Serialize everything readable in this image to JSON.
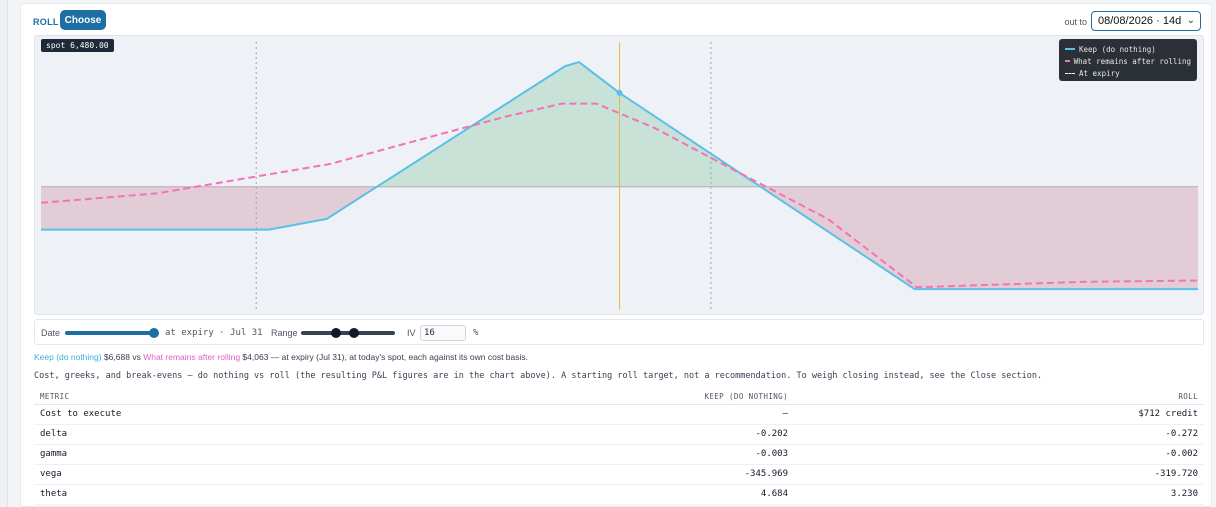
{
  "header": {
    "roll_label": "ROLL",
    "choose_label": "Choose",
    "out_to_label": "out to",
    "date_value": "08/08/2026 · 14d"
  },
  "chart": {
    "spot_label": "spot 6,480.00",
    "legend": [
      {
        "label": "Keep (do nothing)"
      },
      {
        "label": "What remains after rolling"
      },
      {
        "label": "At expiry"
      }
    ]
  },
  "chart_data": {
    "type": "line",
    "x_domain": [
      0,
      1
    ],
    "y_domain": [
      0,
      1
    ],
    "zero_level": 0.46,
    "spot_x": 0.5,
    "breakeven_lines": [
      0.186,
      0.579
    ],
    "series": [
      {
        "name": "Keep (do nothing)",
        "color": "#5bc0e8",
        "style": "solid",
        "points": [
          [
            0,
            0.3
          ],
          [
            0.197,
            0.3
          ],
          [
            0.247,
            0.34
          ],
          [
            0.453,
            0.91
          ],
          [
            0.465,
            0.925
          ],
          [
            0.5,
            0.81
          ],
          [
            0.755,
            0.078
          ],
          [
            1.0,
            0.078
          ]
        ]
      },
      {
        "name": "What remains after rolling",
        "color": "#f472b6",
        "style": "dashed",
        "points": [
          [
            0,
            0.4
          ],
          [
            0.1,
            0.435
          ],
          [
            0.25,
            0.545
          ],
          [
            0.4,
            0.72
          ],
          [
            0.45,
            0.77
          ],
          [
            0.48,
            0.77
          ],
          [
            0.53,
            0.68
          ],
          [
            0.6,
            0.52
          ],
          [
            0.68,
            0.34
          ],
          [
            0.757,
            0.085
          ],
          [
            0.9,
            0.105
          ],
          [
            1.0,
            0.11
          ]
        ]
      }
    ]
  },
  "controls": {
    "date_label": "Date",
    "date_value": "at expiry · Jul 31",
    "range_label": "Range",
    "iv_label": "IV",
    "iv_value": "16",
    "iv_unit": "%",
    "date_slider_fill": 1.0,
    "range_slider_low": 0.38,
    "range_slider_high": 0.55
  },
  "summary": {
    "keep_label": "Keep (do nothing)",
    "keep_value": "$6,688",
    "vs": "vs",
    "roll_label": "What remains after rolling",
    "roll_value": "$4,063",
    "tail": "— at expiry (Jul 31), at today's spot, each against its own cost basis."
  },
  "note": "Cost, greeks, and break-evens — do nothing vs roll (the resulting P&L figures are in the chart above). A starting roll target, not a recommendation. To weigh closing instead, see the Close section.",
  "table": {
    "headers": [
      "METRIC",
      "KEEP (DO NOTHING)",
      "ROLL"
    ],
    "rows": [
      [
        "Cost to execute",
        "—",
        "$712 credit"
      ],
      [
        "delta",
        "-0.202",
        "-0.272"
      ],
      [
        "gamma",
        "-0.003",
        "-0.002"
      ],
      [
        "vega",
        "-345.969",
        "-319.720"
      ],
      [
        "theta",
        "4.684",
        "3.230"
      ]
    ]
  },
  "colors": {
    "accent": "#1d6fa3",
    "keep": "#5bc0e8",
    "roll": "#f472b6",
    "profit_fill": "#c8e2d8",
    "loss_fill": "#e2cdd6",
    "spot_line": "#e6b84a",
    "credit": "#15803d"
  }
}
